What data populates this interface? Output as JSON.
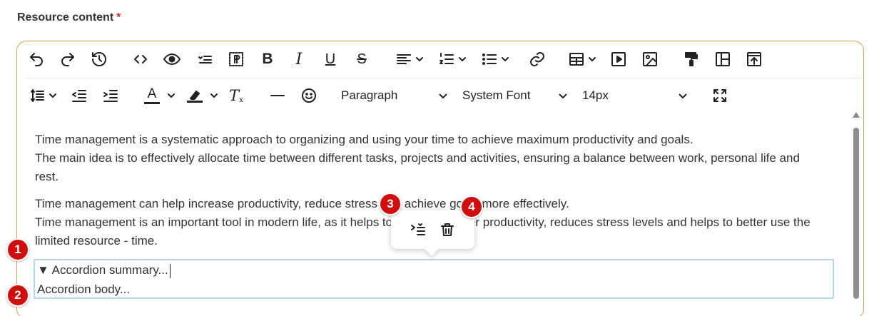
{
  "field": {
    "label": "Resource content",
    "required_mark": "*"
  },
  "toolbar": {
    "row1": [
      "undo-icon",
      "redo-icon",
      "history-icon",
      "source-code-icon",
      "preview-icon",
      "more-list-icon",
      "show-blocks-icon",
      "bold",
      "italic",
      "underline",
      "strikethrough",
      "align-left",
      "numbered-list",
      "bulleted-list",
      "link-icon",
      "table-icon",
      "media-icon",
      "image-icon",
      "format-painter-icon",
      "template-icon",
      "upload-icon"
    ],
    "bold_label": "B",
    "italic_label": "I",
    "underline_label": "U",
    "strike_label": "S",
    "clear_format_label": "T",
    "text_color_label": "A",
    "block_format": "Paragraph",
    "font_family": "System Font",
    "font_size": "14px"
  },
  "content": {
    "paragraph1_line1": "Time management is a systematic approach to organizing and using your time to achieve maximum productivity and goals.",
    "paragraph1_line2": "The main idea is to effectively allocate time between different tasks, projects and activities, ensuring a balance between work, personal life and rest.",
    "paragraph2_line1": "Time management can help increase productivity, reduce stress and achieve goals more effectively.",
    "paragraph2_line2": "Time management is an important tool in modern life, as it helps to achieve greater productivity, reduces stress levels and helps to better use the limited resource - time."
  },
  "accordion": {
    "summary": "▼ Accordion summary...",
    "body": "Accordion body..."
  },
  "badges": {
    "one": "1",
    "two": "2",
    "three": "3",
    "four": "4"
  },
  "colors": {
    "editor_border": "#e29a52",
    "required": "#d9312b",
    "accordion_border": "#b7d4f0",
    "badge": "#d10d0d"
  }
}
